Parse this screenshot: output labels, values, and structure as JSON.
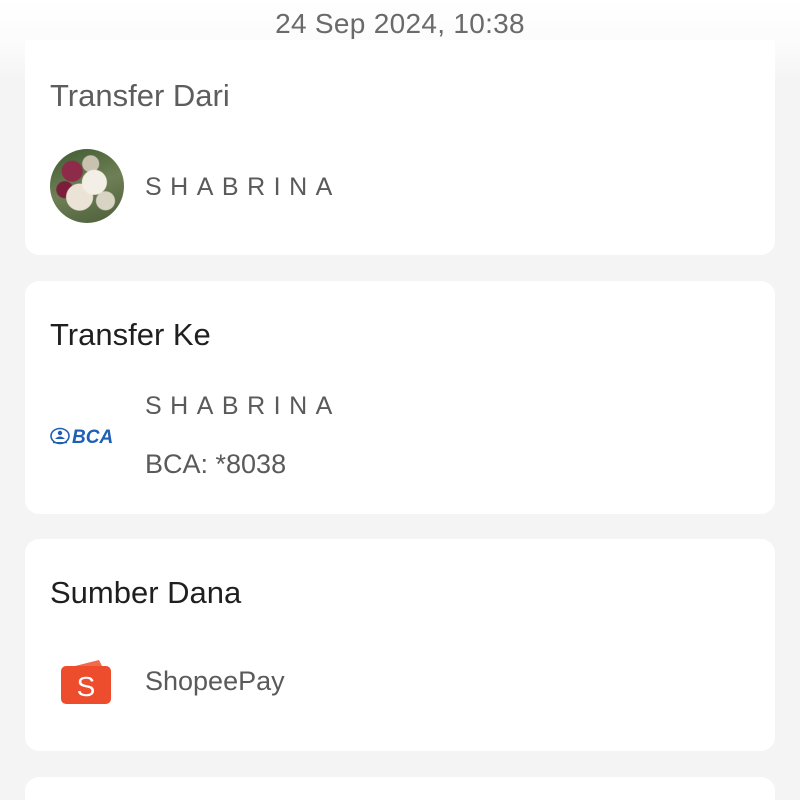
{
  "header": {
    "timestamp": "24 Sep 2024, 10:38"
  },
  "transfer_from": {
    "title": "Transfer Dari",
    "name": "SHABRINA",
    "avatar_icon": "profile-photo-flowers"
  },
  "transfer_to": {
    "title": "Transfer Ke",
    "name": "SHABRINA",
    "bank_logo": "BCA",
    "account": "BCA: *8038"
  },
  "source_of_funds": {
    "title": "Sumber Dana",
    "method": "ShopeePay",
    "icon": "shopeepay-wallet-icon"
  },
  "colors": {
    "bca_blue": "#1f5fb4",
    "shopee_orange": "#ee4d2d"
  }
}
